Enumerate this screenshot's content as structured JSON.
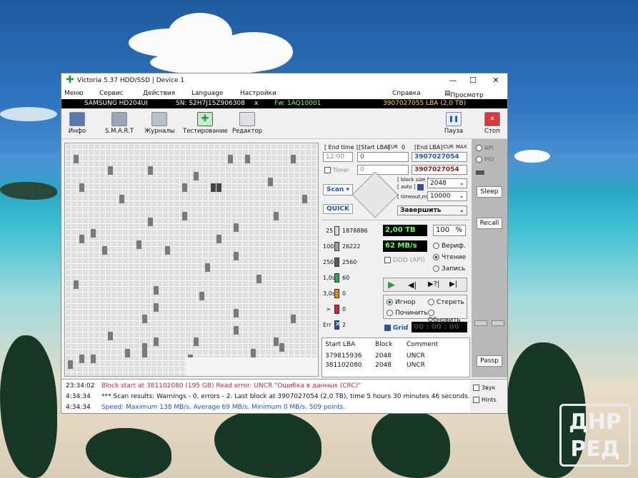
{
  "window": {
    "title": "Victoria 5.37 HDD/SSD | Device 1"
  },
  "menu": [
    "Меню",
    "Сервис",
    "Действия",
    "Language",
    "Настройки",
    "Справка"
  ],
  "buffer_view": "Просмотр буфера",
  "device": {
    "model": "SAMSUNG HD204UI",
    "sn": "SN: S2H7J1SZ906308",
    "x": "x",
    "fw": "Fw: 1AQ10001",
    "lba": "3907027055 LBA (2,0 TB)"
  },
  "toolbar": {
    "info": "Инфо",
    "smart": "S.M.A.R.T",
    "logs": "Журналы",
    "test": "Тестирование",
    "editor": "Редактор",
    "pause": "Пауза",
    "stop": "Стоп"
  },
  "scan": {
    "end_time_label": "[ End time ]",
    "start_lba_label": "[Start LBA]",
    "cur1": "CUR",
    "zero": "0",
    "end_lba_label": "[End LBA]",
    "cur2": "CUR",
    "max": "MAX",
    "time_value": "12:00",
    "start_lba": "0",
    "end_lba": "3907027054",
    "timer_label": "Timer",
    "timer_value": "0",
    "end_lba2": "3907027054",
    "scan_button": "Scan",
    "quick_button": "QUICK",
    "block_size_label": "[ block size ]",
    "auto_label": "[ auto ]",
    "block_size": "2048",
    "timeout_label": "[ timeout,ms ]",
    "timeout": "10000",
    "finish": "Завершить"
  },
  "stats": {
    "rows": [
      {
        "label": "25",
        "count": "1878886",
        "color": "#d9d9d9"
      },
      {
        "label": "100",
        "count": "26222",
        "color": "#a0a0a0"
      },
      {
        "label": "250",
        "count": "2560",
        "color": "#5c5c5c"
      },
      {
        "label": "1,0s",
        "count": "60",
        "color": "#2fa84f"
      },
      {
        "label": "3,0s",
        "count": "0",
        "color": "#e08a1e"
      },
      {
        "label": ">",
        "count": "0",
        "color": "#d22a2a"
      },
      {
        "label": "Err",
        "count": "2",
        "color": "#1f55b0"
      }
    ],
    "capacity": "2,00 TB",
    "percent": "100",
    "percent_unit": "%",
    "speed": "62 MB/s",
    "ddd": "DDD (API)",
    "verify": "Вериф.",
    "read": "Чтение",
    "write": "Запись"
  },
  "actions": {
    "ignore": "Игнор",
    "erase": "Стереть",
    "fix": "Починить",
    "refresh": "Обновить",
    "grid": "Grid",
    "clock": "00 : 00 : 00"
  },
  "table": {
    "headers": [
      "Start LBA",
      "Block",
      "Comment"
    ],
    "rows": [
      [
        "379815936",
        "2048",
        "UNCR"
      ],
      [
        "381102080",
        "2048",
        "UNCR"
      ]
    ]
  },
  "side": {
    "api": "API",
    "pio": "PIO",
    "sleep": "Sleep",
    "recall": "Recall",
    "passp": "Passp"
  },
  "log": [
    {
      "time": "23:34:02",
      "text": "Block start at 381102080 (195 GB) Read error: UNCR \"Ошибка в данных (CRC)\"",
      "color": "red"
    },
    {
      "time": "4:34:34",
      "text": "*** Scan results: Warnings - 0, errors - 2. Last block at 3907027054 (2,0 TB), time 5 hours 30 minutes 46 seconds.",
      "color": "dark"
    },
    {
      "time": "4:34:34",
      "text": "Speed: Maximum 138 MB/s. Average 69 MB/s. Minimum 0 MB/s. 509 points.",
      "color": "blue"
    }
  ],
  "log_options": {
    "sound": "Звук",
    "hints": "Hints"
  },
  "watermark": "ДНР РЕД"
}
